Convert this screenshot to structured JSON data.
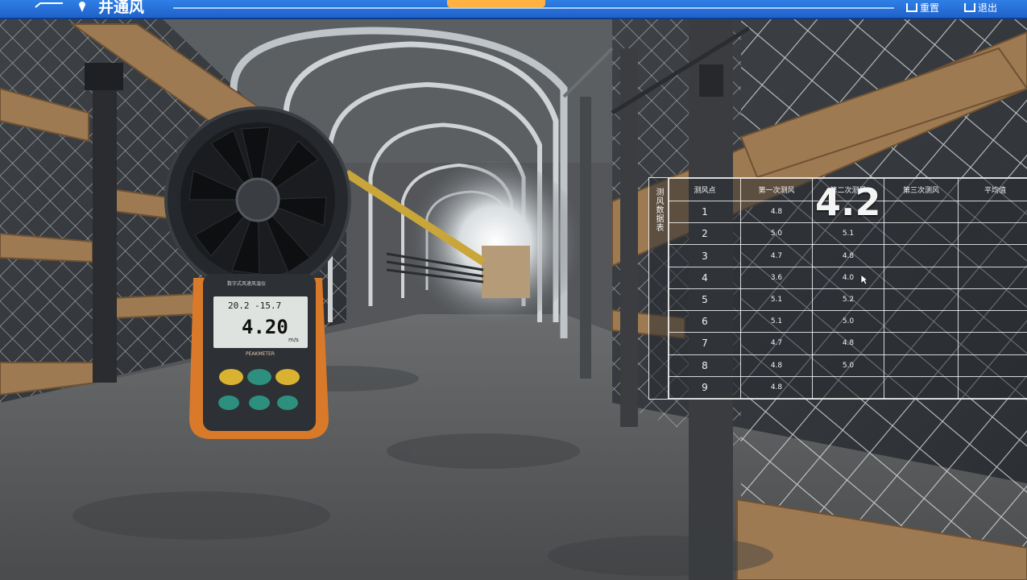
{
  "header": {
    "title": "井通风",
    "reset_label": "重置",
    "exit_label": "退出"
  },
  "meter": {
    "top_readout": "20.2 -15.7",
    "main_reading": "4.20",
    "unit": "m/s",
    "brand": "PEAKMETER",
    "model_text": "数字式风速风温仪"
  },
  "table": {
    "side_title": "测风数据表",
    "columns": [
      "测风点",
      "第一次测风",
      "第二次测风",
      "第三次测风",
      "平均值"
    ],
    "rows": [
      {
        "idx": "1",
        "first": "4.8",
        "second": "",
        "third": "",
        "avg": ""
      },
      {
        "idx": "2",
        "first": "5.0",
        "second": "5.1",
        "third": "",
        "avg": ""
      },
      {
        "idx": "3",
        "first": "4.7",
        "second": "4.8",
        "third": "",
        "avg": ""
      },
      {
        "idx": "4",
        "first": "3.6",
        "second": "4.0",
        "third": "",
        "avg": ""
      },
      {
        "idx": "5",
        "first": "5.1",
        "second": "5.2",
        "third": "",
        "avg": ""
      },
      {
        "idx": "6",
        "first": "5.1",
        "second": "5.0",
        "third": "",
        "avg": ""
      },
      {
        "idx": "7",
        "first": "4.7",
        "second": "4.8",
        "third": "",
        "avg": ""
      },
      {
        "idx": "8",
        "first": "4.8",
        "second": "5.0",
        "third": "",
        "avg": ""
      },
      {
        "idx": "9",
        "first": "4.8",
        "second": "",
        "third": "",
        "avg": ""
      }
    ],
    "live_value": "4.2"
  }
}
